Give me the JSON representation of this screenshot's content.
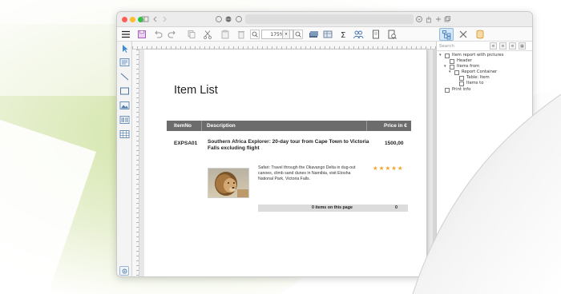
{
  "window": {
    "zoom_value": "175%"
  },
  "report": {
    "title": "Item List",
    "columns": {
      "item_no": "ItemNo",
      "description": "Description",
      "price": "Price in €"
    },
    "item": {
      "number": "EXPSA01",
      "title": "Southern Africa Explorer: 20-day tour from Cape Town to Victoria Falls excluding flight",
      "price": "1500,00",
      "text": "Safari: Travel through the Okavango Delta in dug-out canoes, climb sand dunes in Namibia, visit Etosha National Park, Victoria Falls.",
      "rating_stars": "★★★★★",
      "image": "lion-photo"
    },
    "footer": {
      "label": "0 items on this page",
      "value": "0"
    }
  },
  "panel": {
    "search_placeholder": "Search",
    "tree": [
      "Item report with pictures",
      "Header",
      "Items from",
      "Report Container",
      "Table: Item",
      "Items to",
      "Print info"
    ]
  },
  "colors": {
    "table_header": "#6c6c6c",
    "star": "#f0a830",
    "accent_blue": "#3d8ad6",
    "background_green": "#d3e8a6"
  },
  "icons": {
    "toolbar": [
      "menu-icon",
      "save-icon",
      "undo-icon",
      "redo-icon",
      "copy-icon",
      "cut-icon",
      "paste-icon",
      "delete-icon",
      "zoom-out-icon",
      "zoom-in-icon",
      "layers-icon",
      "table-icon",
      "sum-icon",
      "users-icon",
      "page-icon",
      "preview-icon",
      "structure-icon",
      "tools-icon",
      "database-icon"
    ],
    "palette": [
      "pointer-icon",
      "text-icon",
      "line-icon",
      "rectangle-icon",
      "image-icon",
      "barcode-icon",
      "table-icon",
      "settings-icon"
    ]
  }
}
